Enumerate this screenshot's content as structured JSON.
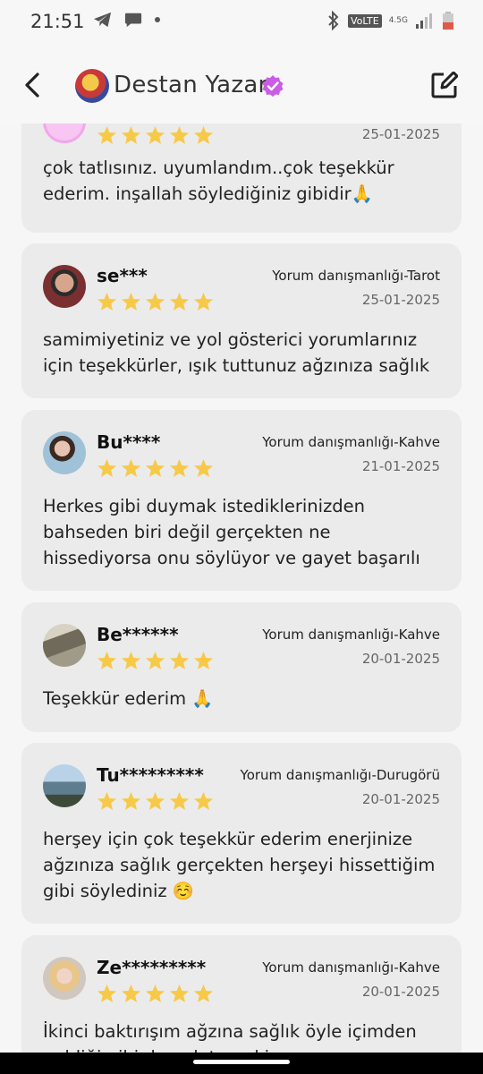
{
  "status_bar": {
    "time": "21:51",
    "volte": "VoLTE",
    "network": "4.5G"
  },
  "header": {
    "title": "Destan Yazar"
  },
  "reviews": [
    {
      "name": "",
      "service": "",
      "date": "25-01-2025",
      "rating": 5,
      "comment": "çok tatlısınız. uyumlandım..çok teşekkür ederim. inşallah söylediğiniz gibidir🙏"
    },
    {
      "name": "se***",
      "service": "Yorum danışmanlığı-Tarot",
      "date": "25-01-2025",
      "rating": 5,
      "comment": "samimiyetiniz ve yol gösterici yorumlarınız için teşekkürler, ışık tuttunuz ağzınıza sağlık"
    },
    {
      "name": "Bu****",
      "service": "Yorum danışmanlığı-Kahve",
      "date": "21-01-2025",
      "rating": 5,
      "comment": "Herkes gibi duymak istediklerinizden bahseden biri değil gerçekten ne hissediyorsa onu söylüyor ve gayet başarılı"
    },
    {
      "name": "Be******",
      "service": "Yorum danışmanlığı-Kahve",
      "date": "20-01-2025",
      "rating": 5,
      "comment": "Teşekkür ederim 🙏"
    },
    {
      "name": "Tu*********",
      "service": "Yorum danışmanlığı-Durugörü",
      "date": "20-01-2025",
      "rating": 5,
      "comment": "herşey için çok teşekkür ederim enerjinize ağzınıza sağlık gerçekten herşeyi hissettiğim gibi söylediniz ☺️"
    },
    {
      "name": "Ze*********",
      "service": "Yorum danışmanlığı-Kahve",
      "date": "20-01-2025",
      "rating": 5,
      "comment": "İkinci baktırışım ağzına sağlık öyle içimden geldiği gibi de anlatıyor ki"
    }
  ],
  "colors": {
    "star": "#f7c948",
    "card": "#ebebeb",
    "verified": "#c95de6"
  },
  "icons": {
    "back": "chevron-left-icon",
    "edit": "edit-icon",
    "verified": "verified-badge-icon",
    "star": "star-icon"
  }
}
